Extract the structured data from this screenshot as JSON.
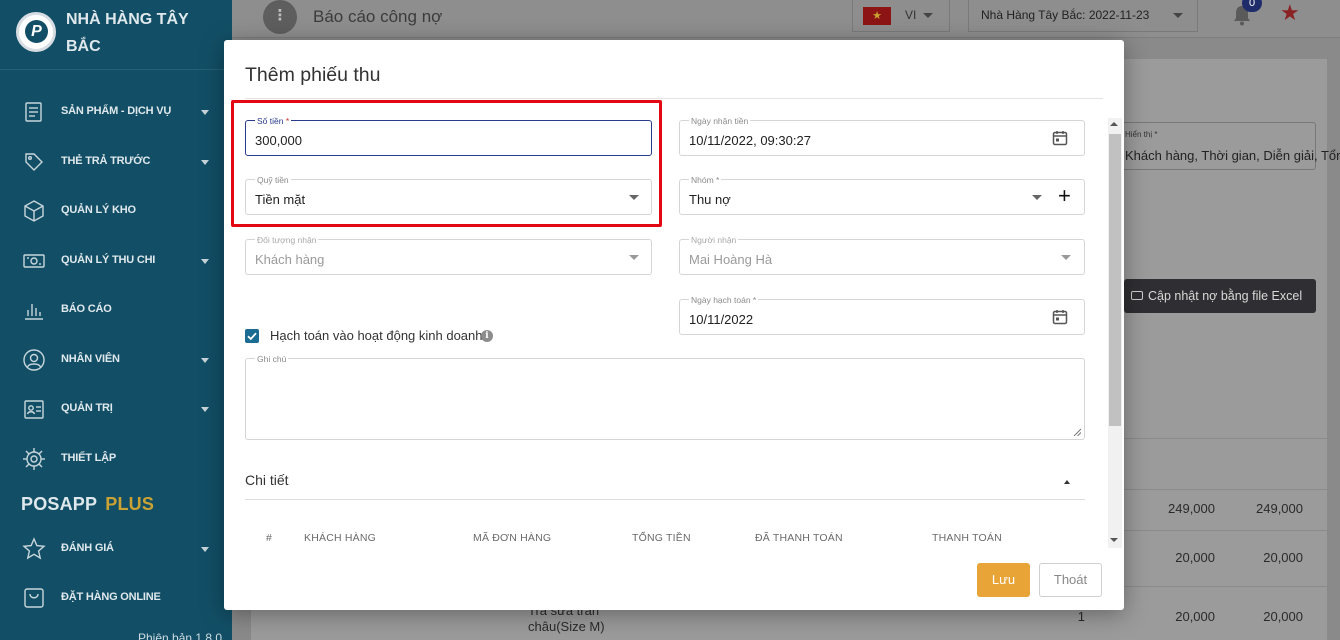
{
  "sidebar": {
    "brand": "NHÀ HÀNG TÂY BẮC",
    "logo_letter": "P",
    "items": [
      {
        "label": "SẢN PHẨM - DỊCH VỤ",
        "icon": "products-icon",
        "has_submenu": true
      },
      {
        "label": "THẺ TRẢ TRƯỚC",
        "icon": "prepaid-card-icon",
        "has_submenu": true
      },
      {
        "label": "QUẢN LÝ KHO",
        "icon": "warehouse-box-icon",
        "has_submenu": false
      },
      {
        "label": "QUẢN LÝ THU CHI",
        "icon": "cash-icon",
        "has_submenu": true
      },
      {
        "label": "BÁO CÁO",
        "icon": "bar-chart-icon",
        "has_submenu": false
      },
      {
        "label": "NHÂN VIÊN",
        "icon": "user-icon",
        "has_submenu": true
      },
      {
        "label": "QUẢN TRỊ",
        "icon": "admin-id-card-icon",
        "has_submenu": true
      },
      {
        "label": "THIẾT LẬP",
        "icon": "gear-icon",
        "has_submenu": false
      }
    ],
    "section_brand": "POSAPP",
    "section_brand_accent": "PLUS",
    "items_plus": [
      {
        "label": "ĐÁNH GIÁ",
        "icon": "star-outline-icon",
        "has_submenu": true
      },
      {
        "label": "ĐẶT HÀNG ONLINE",
        "icon": "shopping-bag-icon",
        "has_submenu": false
      }
    ],
    "version": "Phiên bản 1.8.0"
  },
  "topbar": {
    "menu_glyph": "⋮",
    "page_title": "Báo cáo công nợ",
    "flag_glyph": "★",
    "language": "VI",
    "store": "Nhà Hàng Tây Bắc: 2022-11-23",
    "notification_count": "0",
    "favorite_glyph": "★"
  },
  "background": {
    "display_field_label": "Hiển thị *",
    "display_field_value": "Khách hàng, Thời gian, Diễn giải, Tổng tiền",
    "excel_button": "Cập nhật nợ bằng file Excel",
    "rows": [
      {
        "a": "249,000",
        "b": "249,000"
      },
      {
        "a": "20,000",
        "b": "20,000"
      },
      {
        "qty": "1",
        "a": "20,000",
        "b": "20,000",
        "text1": "Trà sữa trân",
        "text2": "châu(Size M)"
      }
    ]
  },
  "modal": {
    "title": "Thêm phiếu thu",
    "amount": {
      "label": "Số tiền",
      "required_mark": "*",
      "value": "300,000"
    },
    "fund": {
      "label": "Quỹ tiền",
      "value": "Tiền mặt"
    },
    "receiver_object": {
      "label": "Đối tượng nhận",
      "value": "Khách hàng"
    },
    "received_date": {
      "label": "Ngày nhận tiền",
      "value": "10/11/2022, 09:30:27"
    },
    "group": {
      "label": "Nhóm *",
      "value": "Thu nợ"
    },
    "receiver": {
      "label": "Người nhận",
      "value": "Mai Hoàng Hà"
    },
    "accounting_date": {
      "label": "Ngày hạch toán *",
      "value": "10/11/2022"
    },
    "accounting_checkbox": {
      "label": "Hạch toán vào hoạt động kinh doanh",
      "checked": true
    },
    "info_glyph": "i",
    "add_group_glyph": "+",
    "notes": {
      "label": "Ghi chú",
      "value": ""
    },
    "details": {
      "title": "Chi tiết",
      "columns": [
        "#",
        "KHÁCH HÀNG",
        "MÃ ĐƠN HÀNG",
        "TỔNG TIỀN",
        "ĐÃ THANH TOÁN",
        "THANH TOÁN"
      ]
    },
    "save_label": "Lưu",
    "exit_label": "Thoát"
  },
  "colors": {
    "sidebar_bg": "#124f66",
    "accent_blue": "#2a3a8c",
    "highlight_red": "#e30613",
    "save_button": "#e8a436",
    "plus_accent": "#c9a233"
  }
}
